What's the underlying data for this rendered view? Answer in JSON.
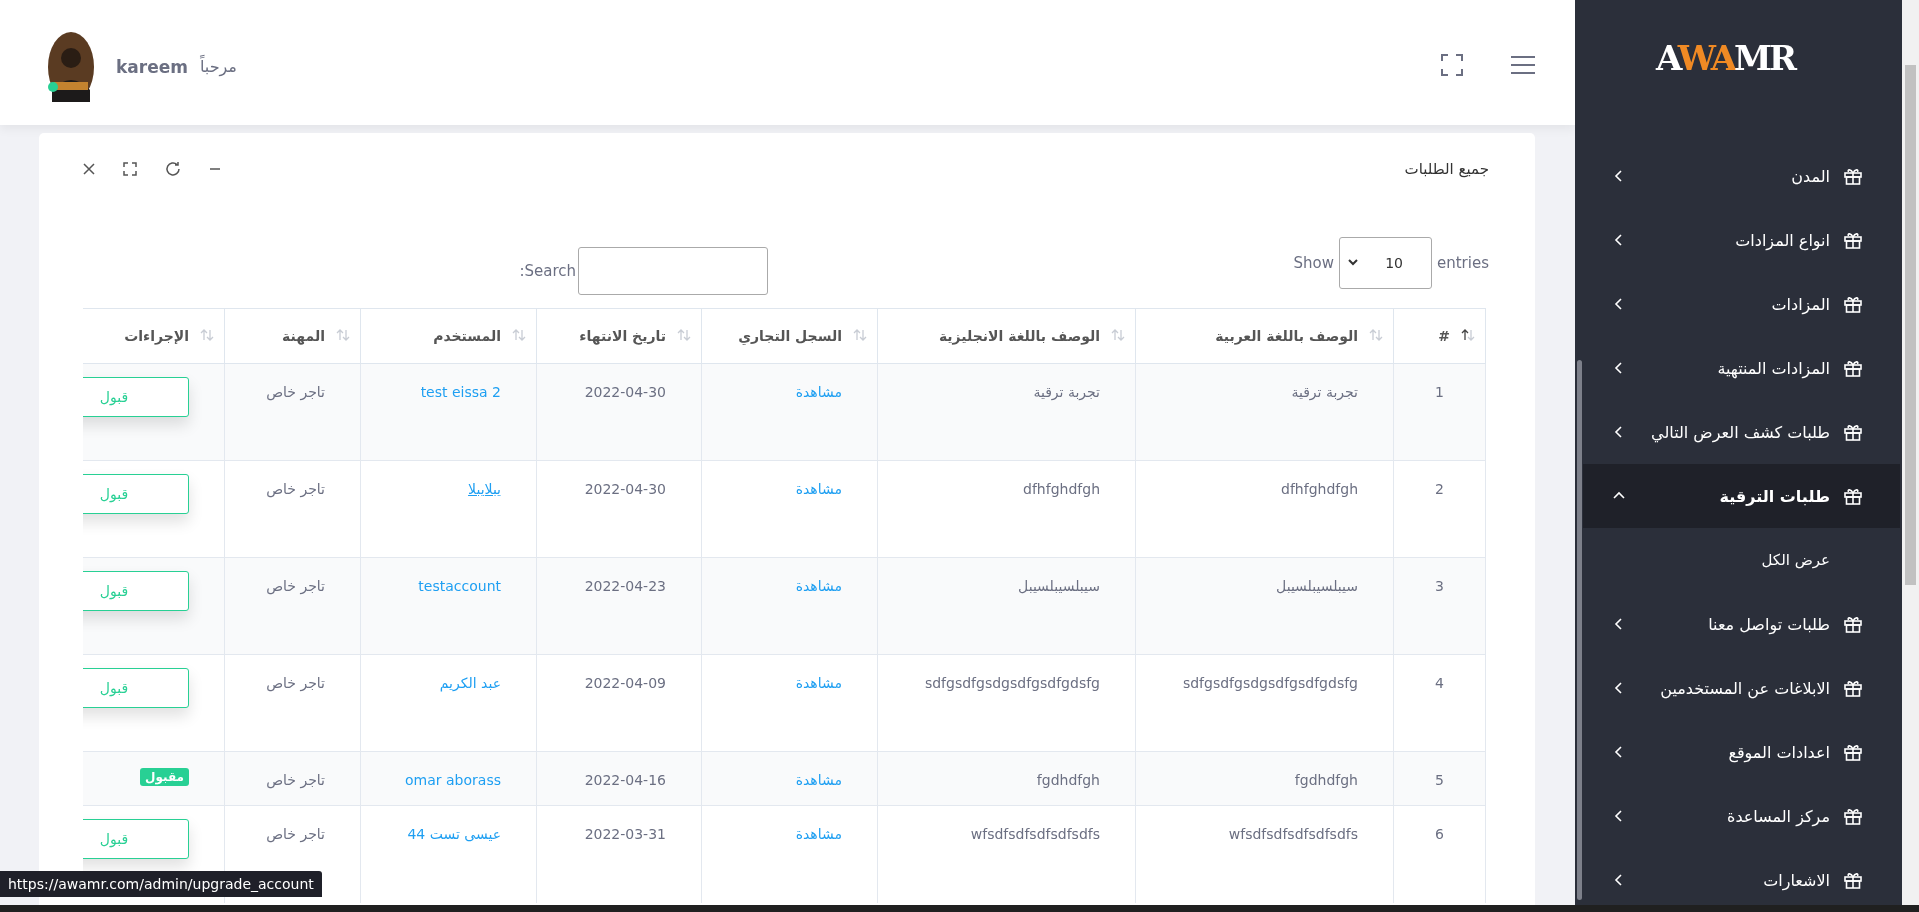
{
  "header": {
    "user_name": "kareem",
    "greeting": "مرحباً",
    "online": true
  },
  "sidebar": {
    "logo": "AWAMR",
    "items": [
      {
        "label": "المدن",
        "selected": false,
        "expanded": false
      },
      {
        "label": "انواع المزادات",
        "selected": false,
        "expanded": false
      },
      {
        "label": "المزادات",
        "selected": false,
        "expanded": false
      },
      {
        "label": "المزادات المنتهية",
        "selected": false,
        "expanded": false
      },
      {
        "label": "طلبات كشف العرض التالي",
        "selected": false,
        "expanded": false
      },
      {
        "label": "طلبات الترقية",
        "selected": true,
        "expanded": true,
        "children": [
          {
            "label": "عرض الكل"
          }
        ]
      },
      {
        "label": "طلبات تواصل معنا",
        "selected": false,
        "expanded": false
      },
      {
        "label": "الابلاغات عن المستخدمين",
        "selected": false,
        "expanded": false
      },
      {
        "label": "اعدادات الموقع",
        "selected": false,
        "expanded": false
      },
      {
        "label": "مركز المساعدة",
        "selected": false,
        "expanded": false
      },
      {
        "label": "الاشعارات",
        "selected": false,
        "expanded": false
      }
    ]
  },
  "card": {
    "title": "جميع الطلبات",
    "length": {
      "show": "Show",
      "value": "10",
      "entries": "entries"
    },
    "search": {
      "label": "Search:"
    },
    "table": {
      "columns": [
        {
          "label": "#",
          "sorted": true
        },
        {
          "label": "الوصف باللغة العربية",
          "sorted": false
        },
        {
          "label": "الوصف باللغة الانجليزية",
          "sorted": false
        },
        {
          "label": "السجل التجاري",
          "sorted": false
        },
        {
          "label": "تاريخ الانتهاء",
          "sorted": false
        },
        {
          "label": "المستخدم",
          "sorted": false
        },
        {
          "label": "المهنة",
          "sorted": false
        },
        {
          "label": "الإجراءات",
          "sorted": false
        }
      ],
      "rows": [
        {
          "num": "1",
          "desc_ar": "تجربة ترقية",
          "desc_en": "تجربة ترقية",
          "register": "مشاهدة",
          "expiry": "2022-04-30",
          "user": "test eissa 2",
          "job": "تاجر خاص",
          "action": {
            "kind": "button",
            "label": "قبول"
          }
        },
        {
          "num": "2",
          "desc_ar": "dfhfghdfgh",
          "desc_en": "dfhfghdfgh",
          "register": "مشاهدة",
          "expiry": "2022-04-30",
          "user": "يبلايبلا",
          "job": "تاجر خاص",
          "action": {
            "kind": "button",
            "label": "قبول"
          }
        },
        {
          "num": "3",
          "desc_ar": "سيبلسيبلسيبل",
          "desc_en": "سيبلسيبلسيبل",
          "register": "مشاهدة",
          "expiry": "2022-04-23",
          "user": "testaccount",
          "job": "تاجر خاص",
          "action": {
            "kind": "button",
            "label": "قبول"
          }
        },
        {
          "num": "4",
          "desc_ar": "sdfgsdfgsdgsdfgsdfgdsfg",
          "desc_en": "sdfgsdfgsdgsdfgsdfgdsfg",
          "register": "مشاهدة",
          "expiry": "2022-04-09",
          "user": "عبد الكريم",
          "job": "تاجر خاص",
          "action": {
            "kind": "button",
            "label": "قبول"
          }
        },
        {
          "num": "5",
          "desc_ar": "fgdhdfgh",
          "desc_en": "fgdhdfgh",
          "register": "مشاهدة",
          "expiry": "2022-04-16",
          "user": "omar aborass",
          "job": "تاجر خاص",
          "action": {
            "kind": "badge",
            "label": "مقبول"
          }
        },
        {
          "num": "6",
          "desc_ar": "wfsdfsdfsdfsdfsdfs",
          "desc_en": "wfsdfsdfsdfsdfsdfs",
          "register": "مشاهدة",
          "expiry": "2022-03-31",
          "user": "عيسى تست 44",
          "job": "تاجر خاص",
          "action": {
            "kind": "button",
            "label": "قبول"
          }
        }
      ]
    }
  },
  "status_url": "https://awamr.com/admin/upgrade_account"
}
